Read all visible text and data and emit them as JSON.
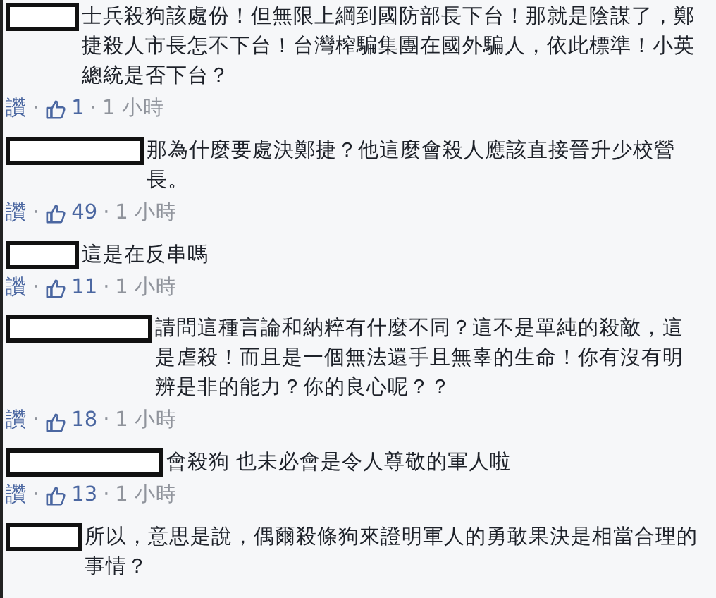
{
  "comments": [
    {
      "text": "士兵殺狗該處份！但無限上綱到國防部長下台！那就是陰謀了，鄭捷殺人市長怎不下台！台灣榨騙集團在國外騙人，依此標準！小英總統是否下台？",
      "like_action": "讚",
      "dot_1": "·",
      "likes": "1",
      "dot_2": "·",
      "time": "1 小時"
    },
    {
      "text": "那為什麼要處決鄭捷？他這麼會殺人應該直接晉升少校營長。",
      "like_action": "讚",
      "dot_1": "·",
      "likes": "49",
      "dot_2": "·",
      "time": "1 小時"
    },
    {
      "text": "這是在反串嗎",
      "like_action": "讚",
      "dot_1": "·",
      "likes": "11",
      "dot_2": "·",
      "time": "1 小時"
    },
    {
      "text": "請問這種言論和納粹有什麼不同？這不是單純的殺敵，這是虐殺！而且是一個無法還手且無辜的生命！你有沒有明辨是非的能力？你的良心呢？？",
      "like_action": "讚",
      "dot_1": "·",
      "likes": "18",
      "dot_2": "·",
      "time": "1 小時"
    },
    {
      "text": "會殺狗 也未必會是令人尊敬的軍人啦",
      "like_action": "讚",
      "dot_1": "·",
      "likes": "13",
      "dot_2": "·",
      "time": "1 小時"
    },
    {
      "text": "所以，意思是說，偶爾殺條狗來證明軍人的勇敢果決是相當合理的事情？"
    }
  ]
}
